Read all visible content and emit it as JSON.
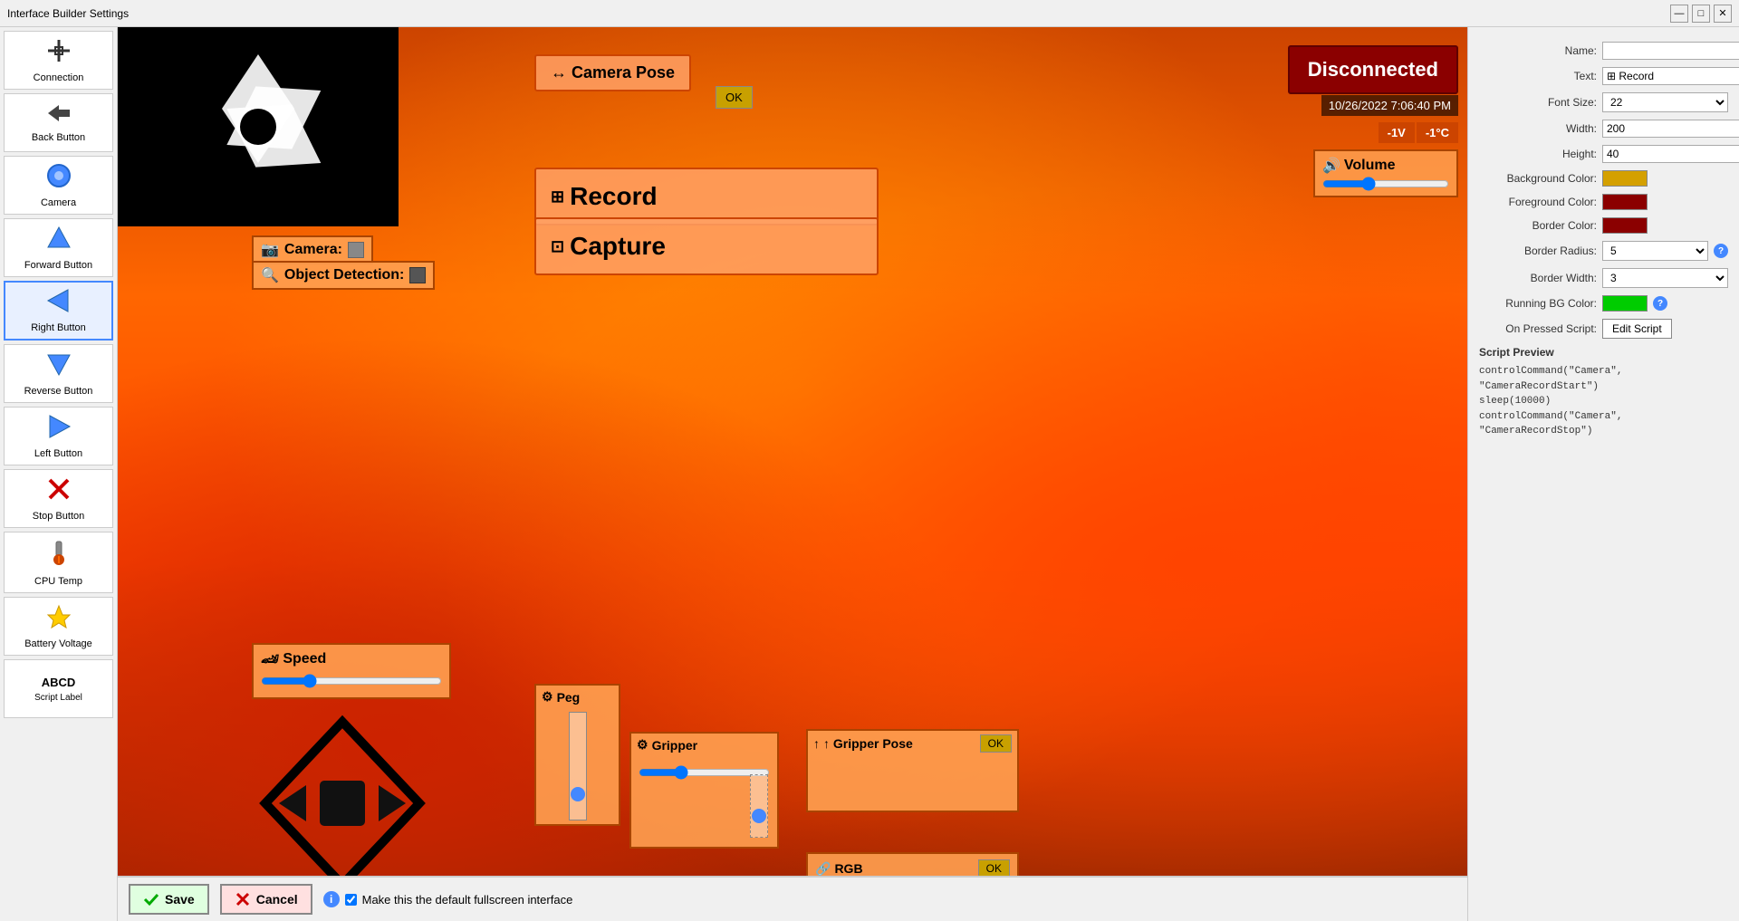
{
  "window": {
    "title": "Interface Builder Settings"
  },
  "sidebar": {
    "items": [
      {
        "id": "connection",
        "label": "Connection",
        "icon": "⊕"
      },
      {
        "id": "back-button",
        "label": "Back Button",
        "icon": "↩"
      },
      {
        "id": "camera",
        "label": "Camera",
        "icon": "🔵"
      },
      {
        "id": "forward-button",
        "label": "Forward Button",
        "icon": "▲"
      },
      {
        "id": "right-button",
        "label": "Right Button",
        "icon": "▶"
      },
      {
        "id": "reverse-button",
        "label": "Reverse Button",
        "icon": "▼"
      },
      {
        "id": "left-button",
        "label": "Left Button",
        "icon": "◀"
      },
      {
        "id": "stop-button",
        "label": "Stop Button",
        "icon": "✕"
      },
      {
        "id": "cpu-temp",
        "label": "CPU Temp",
        "icon": "🌡"
      },
      {
        "id": "battery-voltage",
        "label": "Battery Voltage",
        "icon": "⚡"
      },
      {
        "id": "script-label",
        "label": "ABCD\nScript Label",
        "icon": "📝"
      }
    ]
  },
  "canvas": {
    "disconnected_label": "Disconnected",
    "datetime": "10/26/2022 7:06:40 PM",
    "temp1": "-1V",
    "temp2": "-1°C",
    "volume_label": "Volume",
    "record_label": "Record",
    "capture_label": "Capture",
    "camera_pose_label": "↔ Camera Pose",
    "camera_label": "Camera:",
    "object_detection_label": "Object Detection:",
    "speed_label": "Speed",
    "peg_label": "Peg",
    "gripper_label": "Gripper",
    "gripper_pose_label": "↑ Gripper Pose",
    "rgb_label": "RGB",
    "ok_label": "OK"
  },
  "properties": {
    "name_label": "Name:",
    "name_value": "",
    "text_label": "Text:",
    "text_value": "⊞ Record",
    "font_size_label": "Font Size:",
    "font_size_value": "22",
    "width_label": "Width:",
    "width_value": "200",
    "height_label": "Height:",
    "height_value": "40",
    "bg_color_label": "Background Color:",
    "fg_color_label": "Foreground Color:",
    "border_color_label": "Border Color:",
    "border_radius_label": "Border Radius:",
    "border_radius_value": "5",
    "border_width_label": "Border Width:",
    "border_width_value": "3",
    "running_bg_label": "Running BG Color:",
    "on_pressed_label": "On Pressed Script:",
    "edit_script_label": "Edit Script",
    "script_preview_label": "Script Preview",
    "script_line1": "controlCommand(\"Camera\", \"CameraRecordStart\")",
    "script_line2": "sleep(10000)",
    "script_line3": "controlCommand(\"Camera\", \"CameraRecordStop\")"
  },
  "bottom_bar": {
    "save_label": "Save",
    "cancel_label": "Cancel",
    "default_interface_label": "Make this the default fullscreen interface"
  }
}
